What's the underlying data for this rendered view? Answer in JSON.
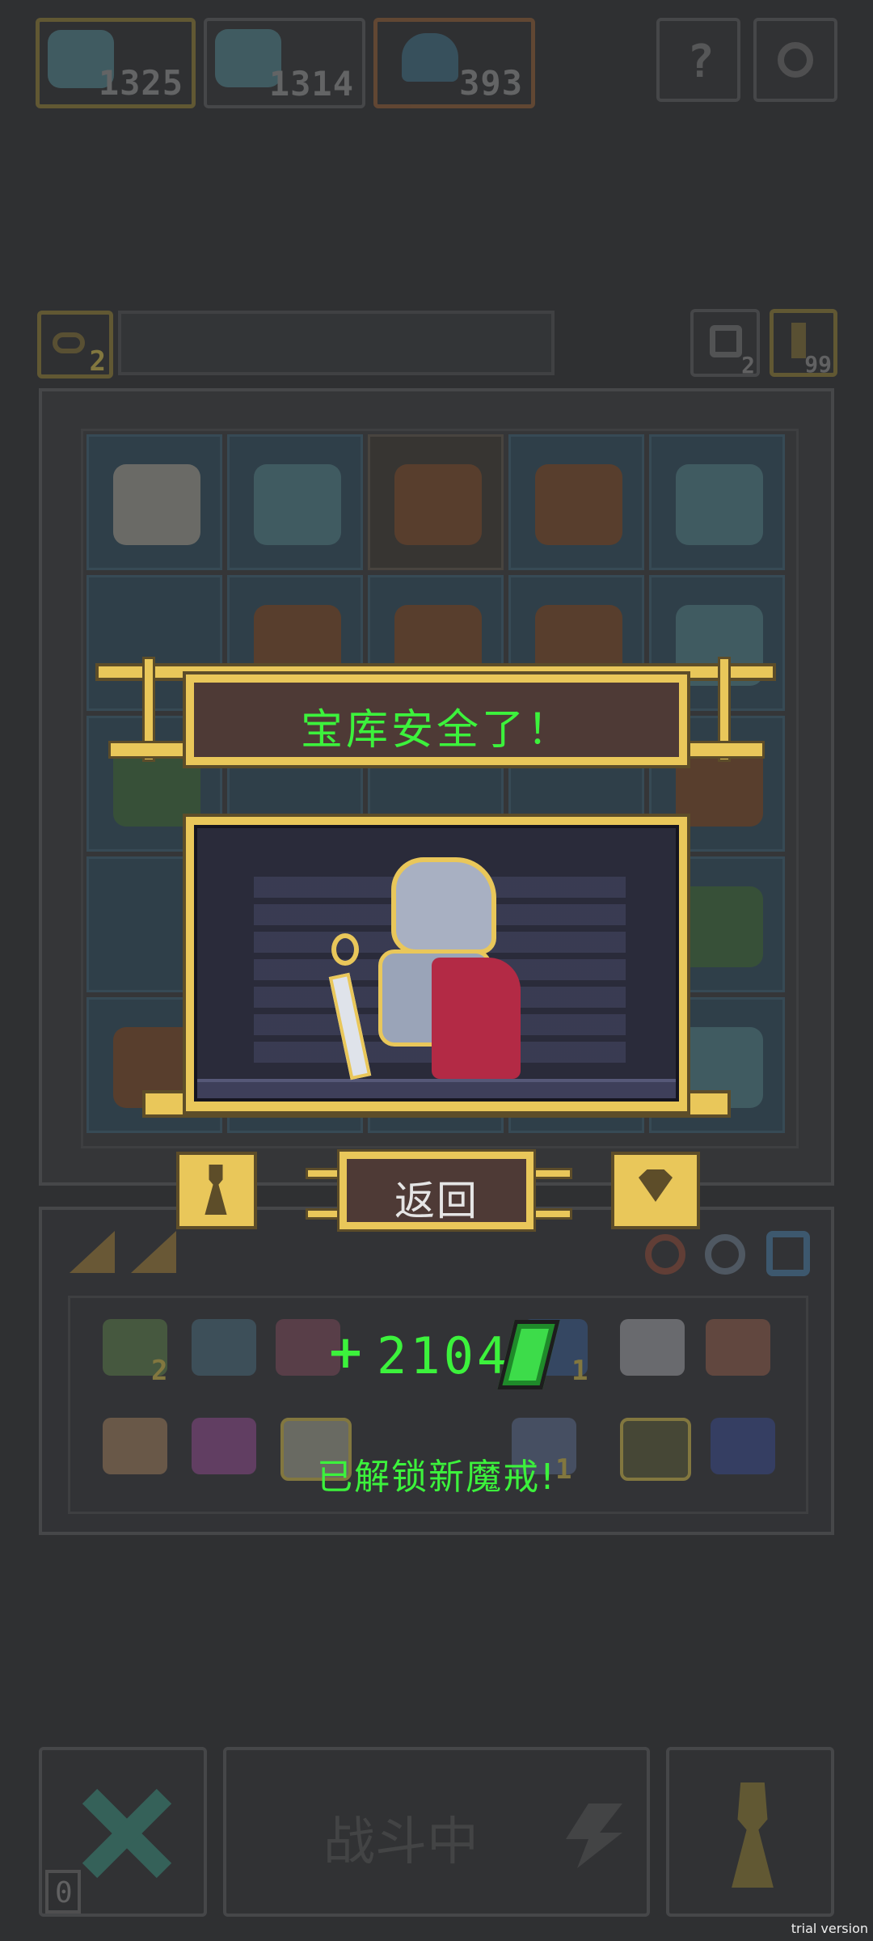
{
  "resources": {
    "res1_value": "1325",
    "res2_value": "1314",
    "res3_value": "393"
  },
  "top_buttons": {
    "help_icon": "?"
  },
  "vault_bar": {
    "key_count": "2",
    "refresh_count": "2",
    "potion_count": "99"
  },
  "modal": {
    "title": "宝库安全了！",
    "back_label": "返回"
  },
  "reward": {
    "plus": "+",
    "amount": "2104",
    "unlock_text": "已解锁新魔戒!"
  },
  "inventory_counts": {
    "a": "2",
    "b": "1",
    "c": "1"
  },
  "bottom": {
    "battle_label": "战斗中",
    "corner_count": "0"
  },
  "watermark": "trial version",
  "colors": {
    "accent_gold": "#e9c75a",
    "reward_green": "#3cf23c",
    "modal_dark": "#4e3a36"
  }
}
